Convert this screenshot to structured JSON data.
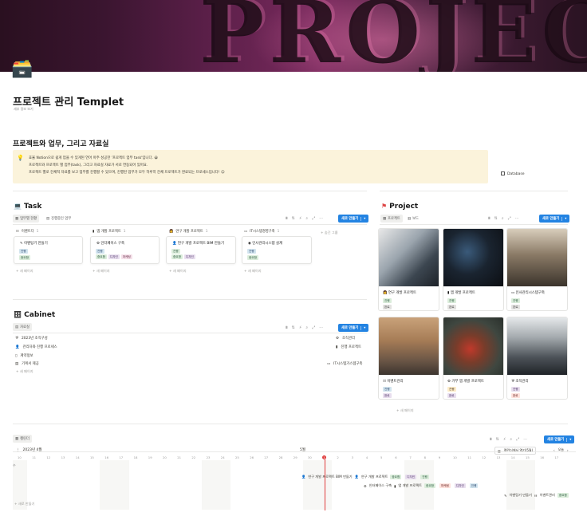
{
  "page": {
    "title": "프로젝트 관리 Templet",
    "subtitle": "세부 정보 보기",
    "section_heading": "프로젝트와 업무, 그리고 자료실",
    "callout_lines": [
      "효율 Notion으로 쉽게 업을 수 있게된 언어 아주 성공한 '프로젝트 업무 task'입니다. 😀",
      "프로젝트와 프로젝트 별 업무(task), 그리고 자료실 자료가 서로 연동되어 있어요.",
      "프로젝트 별로 전체적 자료를 보고 업무를 진행할 수 있으며, 진행된 업무가 모두 하루히 전체 프로젝트가 완료되는 프로세스입니다! 😊"
    ],
    "database_label": "Database"
  },
  "task": {
    "title": "Task",
    "tabs": [
      "업무별 현황",
      "진행중인 업무"
    ],
    "new_label": "새로 만들기",
    "hidden_group": "+ 숨긴 그룹",
    "columns": [
      {
        "header": "이벤트다",
        "count": "1",
        "card_title": "이벤팅기 만들기",
        "tags": [
          {
            "label": "진행",
            "color": "blue"
          },
          {
            "label": "중요함",
            "color": "green"
          }
        ],
        "add": "+ 새 페이지"
      },
      {
        "header": "앱 개발 프로젝트",
        "count": "1",
        "card_title": "인터페이스 구축",
        "tags": [
          {
            "label": "진행",
            "color": "blue"
          },
          {
            "label": "중요함",
            "color": "green"
          },
          {
            "label": "디자인",
            "color": "purple"
          },
          {
            "label": "마케팅",
            "color": "pink"
          }
        ],
        "add": "+ 새 페이지"
      },
      {
        "header": "연구 개발 프로젝트",
        "count": "1",
        "card_title": "연구 개발 프로젝트 BIM 만들기",
        "tags": [
          {
            "label": "진행",
            "color": "green"
          },
          {
            "label": "중요함",
            "color": "green"
          },
          {
            "label": "디자인",
            "color": "purple"
          }
        ],
        "add": "+ 새 페이지"
      },
      {
        "header": "IT시스템경영구축",
        "count": "1",
        "card_title": "인사관리시스템 설계",
        "tags": [
          {
            "label": "진행",
            "color": "blue"
          },
          {
            "label": "중요함",
            "color": "green"
          }
        ],
        "add": "+ 새 페이지"
      }
    ]
  },
  "cabinet": {
    "title": "Cabinet",
    "tab": "자료실",
    "new_label": "새로 만들기",
    "rows": [
      {
        "name": "2023년 조직구성",
        "link": "조직관리"
      },
      {
        "name": "관리자와 진행 프로세스",
        "link": "진행 프로젝트"
      },
      {
        "name": "계약정보",
        "link": ""
      },
      {
        "name": "기획서 제공",
        "link": "IT시스템가스템구축"
      }
    ],
    "add": "+ 새 페이지"
  },
  "project": {
    "title": "Project",
    "tabs": [
      "프로젝트",
      "보드"
    ],
    "new_label": "새로 만들기",
    "cards": [
      {
        "title": "연구 개발 프로젝트",
        "tags": [
          {
            "label": "진행",
            "color": "green"
          },
          {
            "label": "완료",
            "color": "gray"
          }
        ]
      },
      {
        "title": "앱 개발 프로젝트",
        "tags": [
          {
            "label": "진행",
            "color": "green"
          },
          {
            "label": "완료",
            "color": "gray"
          }
        ]
      },
      {
        "title": "인사관리시스템구축",
        "tags": [
          {
            "label": "진행",
            "color": "green"
          },
          {
            "label": "완료",
            "color": "gray"
          }
        ]
      },
      {
        "title": "이벤트관리",
        "tags": [
          {
            "label": "진행",
            "color": "blue"
          },
          {
            "label": "완료",
            "color": "purple"
          }
        ]
      },
      {
        "title": "가부 앱 개발 프로젝트",
        "tags": [
          {
            "label": "진행",
            "color": "yellow"
          },
          {
            "label": "완료",
            "color": "purple"
          }
        ]
      },
      {
        "title": "조직관리",
        "tags": [
          {
            "label": "진행",
            "color": "purple"
          },
          {
            "label": "완료",
            "color": "red"
          }
        ]
      }
    ],
    "add": "+ 새 페이지"
  },
  "timeline": {
    "tab": "캘린더",
    "month": "2023년 4월",
    "next_month": "5월",
    "new_label": "새로 만들기",
    "open_label": "캘린더에서 열기(5월)",
    "today_label": "오늘",
    "add": "+ 새로 만들기",
    "days": [
      "10",
      "11",
      "12",
      "13",
      "14",
      "15",
      "16",
      "17",
      "18",
      "19",
      "20",
      "21",
      "22",
      "23",
      "24",
      "25",
      "26",
      "27",
      "28",
      "29",
      "30",
      "1",
      "2",
      "3",
      "4",
      "5",
      "6",
      "7",
      "8",
      "9",
      "10",
      "11",
      "12",
      "13",
      "14",
      "15",
      "16",
      "17"
    ],
    "today_index": 21,
    "bars": [
      {
        "label": "연구 개발 프로젝트 BIM 만들기",
        "link": "연구 개발 프로젝트",
        "tags": [
          {
            "label": "중요함",
            "color": "green"
          },
          {
            "label": "디자인",
            "color": "purple"
          },
          {
            "label": "진행",
            "color": "green"
          }
        ]
      },
      {
        "label": "인터페이스 구축",
        "link": "앱 개발 프로젝트",
        "tags": [
          {
            "label": "중요함",
            "color": "green"
          },
          {
            "label": "마케팅",
            "color": "red"
          },
          {
            "label": "디자인",
            "color": "purple"
          },
          {
            "label": "진행",
            "color": "blue"
          }
        ]
      },
      {
        "label": "이벤팅기 만들기",
        "link": "이벤트관리",
        "tags": [
          {
            "label": "중요함",
            "color": "green"
          }
        ]
      }
    ]
  }
}
